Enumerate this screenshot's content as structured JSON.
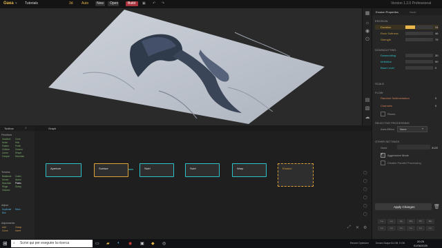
{
  "titlebar": {
    "app_name": "Gaea",
    "menu": "▾",
    "project": "Tutorials",
    "mode": "3d",
    "auto": "Auto",
    "new_label": "New",
    "open_label": "Open",
    "build_label": "Build",
    "version": "Version 1.2.0 Professional"
  },
  "viewport": {
    "shaded_colors": {
      "light": "#c8cdd5",
      "dark": "#2f3a4a",
      "background": "#2a2a2a"
    }
  },
  "props": {
    "tabs": [
      "Erosion Properties",
      "Node"
    ],
    "sections": {
      "erosion": "EROSION",
      "downcutting": "DOWNCUTTING",
      "scale": "SCALE",
      "flow": "FLOW",
      "selective": "SELECTIVE PROCESSING",
      "other": "OTHER SETTINGS"
    },
    "erosion_rows": [
      {
        "label": "Duration",
        "value": "34",
        "unit": "%",
        "fill": 0.34,
        "color": "#e8b64a"
      },
      {
        "label": "Rock Softness",
        "value": "46",
        "unit": "%",
        "fill": 0.46,
        "color": "#c8a040"
      },
      {
        "label": "Strength",
        "value": "75",
        "unit": "%",
        "fill": 0.75,
        "color": "#c8a040"
      }
    ],
    "downcut_rows": [
      {
        "label": "Downcutting",
        "value": "30",
        "unit": "%",
        "fill": 0.3
      },
      {
        "label": "Inhibition",
        "value": "50",
        "unit": "%",
        "fill": 0.5
      },
      {
        "label": "Base Level",
        "value": "0",
        "unit": "%",
        "fill": 0.0
      }
    ],
    "flow_rows": [
      {
        "label": "Random Sedimentation",
        "value": "0",
        "unit": "%"
      },
      {
        "label": "Channels",
        "value": "0",
        "unit": "%"
      }
    ],
    "flow_check": "Rivers",
    "area_effect_label": "Area Effect",
    "area_effect_value": "None",
    "seed_label": "Seed",
    "seed_value": "3120",
    "aggressive": "Aggressive Mode",
    "deterministic": "Disable Parallel Processing",
    "apply_button": "Apply Changes",
    "preset_buttons": [
      "Lo",
      "Lo",
      "Hy",
      "Pre",
      "Pri",
      "Ba",
      "Lo",
      "Lo",
      "Lo",
      "Lo",
      "Lo",
      "Lo"
    ]
  },
  "toolbox": {
    "title": "Toolbox",
    "groups": [
      {
        "header": "Primitives",
        "items": [
          "Gradient",
          "Cone",
          "Noise",
          "Hills",
          "Pattern",
          "Perlin",
          "Cellular",
          "Voronoi",
          "Linear",
          "Shape",
          "Canyon",
          "Mountain"
        ]
      },
      {
        "header": "Terrains",
        "items": [
          "Badlands",
          "Crater",
          "Dunes",
          "Island",
          "Mountain",
          "Plates",
          "Ridge",
          "Slump",
          "Volcano"
        ]
      },
      {
        "header": "Adjust",
        "items": [
          "Duplicate",
          "Mixer",
          "Blur"
        ]
      },
      {
        "header": "Adjustments",
        "items": [
          "Add",
          "Clamp",
          "Curve",
          "Invert"
        ]
      }
    ]
  },
  "graph": {
    "tab": "Graph",
    "nodes": [
      "Aperture",
      "Surface",
      "Swirl",
      "Swirl",
      "Warp",
      "Erosion"
    ],
    "connector_color": "#2ec3c9",
    "selected_color": "#e2a33a"
  },
  "taskbar": {
    "search_placeholder": "Scrivi qui per eseguire la ricerca",
    "status_a": "Recent Optimizer",
    "status_b": "Dream Scape 64 GB",
    "status_c": "5 GB",
    "time": "20:25",
    "date": "01/06/2020"
  }
}
